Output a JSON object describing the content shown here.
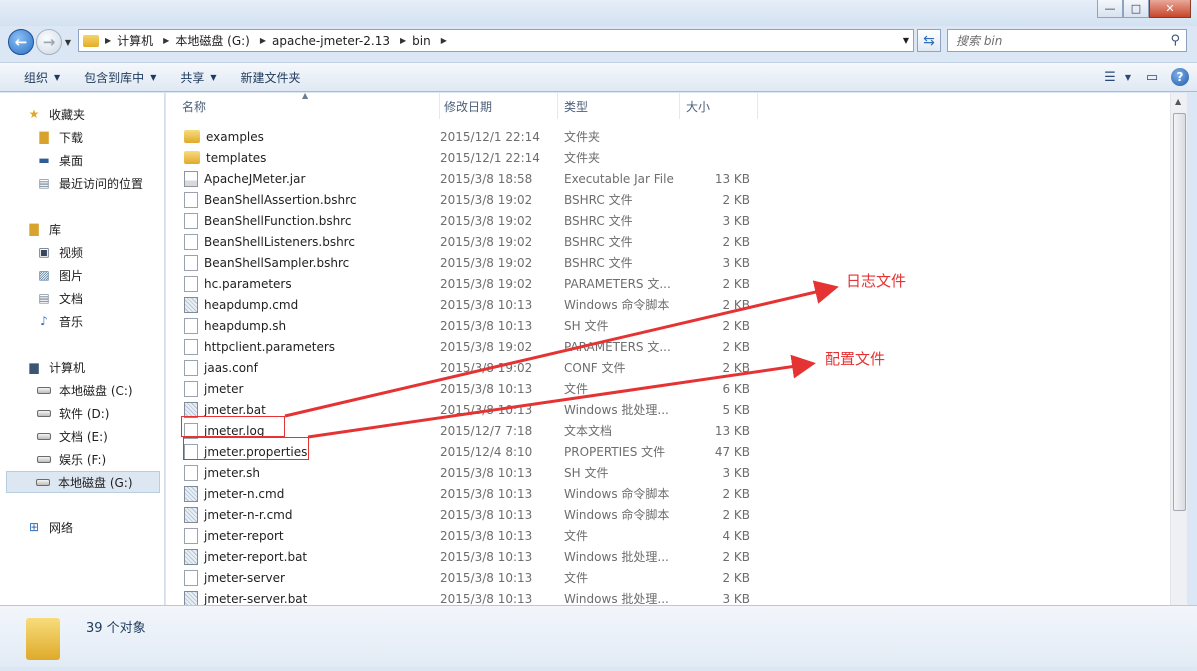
{
  "window": {
    "buttons": [
      "—",
      "□",
      "✕"
    ]
  },
  "address": {
    "crumbs": [
      "计算机",
      "本地磁盘 (G:)",
      "apache-jmeter-2.13",
      "bin"
    ],
    "search_placeholder": "搜索 bin"
  },
  "toolbar": {
    "organize": "组织",
    "include_library": "包含到库中",
    "share": "共享",
    "new_folder": "新建文件夹"
  },
  "nav": {
    "favorites": "收藏夹",
    "downloads": "下载",
    "desktop": "桌面",
    "recent": "最近访问的位置",
    "libraries": "库",
    "videos": "视频",
    "pictures": "图片",
    "documents": "文档",
    "music": "音乐",
    "computer": "计算机",
    "drive_c": "本地磁盘 (C:)",
    "drive_d": "软件 (D:)",
    "drive_e": "文档 (E:)",
    "drive_f": "娱乐 (F:)",
    "drive_g": "本地磁盘 (G:)",
    "network": "网络"
  },
  "columns": {
    "name": "名称",
    "date": "修改日期",
    "type": "类型",
    "size": "大小"
  },
  "files": [
    {
      "name": "examples",
      "date": "2015/12/1 22:14",
      "type": "文件夹",
      "size": "",
      "icon": "folder"
    },
    {
      "name": "templates",
      "date": "2015/12/1 22:14",
      "type": "文件夹",
      "size": "",
      "icon": "folder"
    },
    {
      "name": "ApacheJMeter.jar",
      "date": "2015/3/8 18:58",
      "type": "Executable Jar File",
      "size": "13 KB",
      "icon": "jar"
    },
    {
      "name": "BeanShellAssertion.bshrc",
      "date": "2015/3/8 19:02",
      "type": "BSHRC 文件",
      "size": "2 KB",
      "icon": "file"
    },
    {
      "name": "BeanShellFunction.bshrc",
      "date": "2015/3/8 19:02",
      "type": "BSHRC 文件",
      "size": "3 KB",
      "icon": "file"
    },
    {
      "name": "BeanShellListeners.bshrc",
      "date": "2015/3/8 19:02",
      "type": "BSHRC 文件",
      "size": "2 KB",
      "icon": "file"
    },
    {
      "name": "BeanShellSampler.bshrc",
      "date": "2015/3/8 19:02",
      "type": "BSHRC 文件",
      "size": "3 KB",
      "icon": "file"
    },
    {
      "name": "hc.parameters",
      "date": "2015/3/8 19:02",
      "type": "PARAMETERS 文...",
      "size": "2 KB",
      "icon": "file"
    },
    {
      "name": "heapdump.cmd",
      "date": "2015/3/8 10:13",
      "type": "Windows 命令脚本",
      "size": "2 KB",
      "icon": "app"
    },
    {
      "name": "heapdump.sh",
      "date": "2015/3/8 10:13",
      "type": "SH 文件",
      "size": "2 KB",
      "icon": "file"
    },
    {
      "name": "httpclient.parameters",
      "date": "2015/3/8 19:02",
      "type": "PARAMETERS 文...",
      "size": "2 KB",
      "icon": "file"
    },
    {
      "name": "jaas.conf",
      "date": "2015/3/8 19:02",
      "type": "CONF 文件",
      "size": "2 KB",
      "icon": "file"
    },
    {
      "name": "jmeter",
      "date": "2015/3/8 10:13",
      "type": "文件",
      "size": "6 KB",
      "icon": "file"
    },
    {
      "name": "jmeter.bat",
      "date": "2015/3/8 10:13",
      "type": "Windows 批处理...",
      "size": "5 KB",
      "icon": "app"
    },
    {
      "name": "jmeter.log",
      "date": "2015/12/7 7:18",
      "type": "文本文档",
      "size": "13 KB",
      "icon": "file"
    },
    {
      "name": "jmeter.properties",
      "date": "2015/12/4 8:10",
      "type": "PROPERTIES 文件",
      "size": "47 KB",
      "icon": "file"
    },
    {
      "name": "jmeter.sh",
      "date": "2015/3/8 10:13",
      "type": "SH 文件",
      "size": "3 KB",
      "icon": "file"
    },
    {
      "name": "jmeter-n.cmd",
      "date": "2015/3/8 10:13",
      "type": "Windows 命令脚本",
      "size": "2 KB",
      "icon": "app"
    },
    {
      "name": "jmeter-n-r.cmd",
      "date": "2015/3/8 10:13",
      "type": "Windows 命令脚本",
      "size": "2 KB",
      "icon": "app"
    },
    {
      "name": "jmeter-report",
      "date": "2015/3/8 10:13",
      "type": "文件",
      "size": "4 KB",
      "icon": "file"
    },
    {
      "name": "jmeter-report.bat",
      "date": "2015/3/8 10:13",
      "type": "Windows 批处理...",
      "size": "2 KB",
      "icon": "app"
    },
    {
      "name": "jmeter-server",
      "date": "2015/3/8 10:13",
      "type": "文件",
      "size": "2 KB",
      "icon": "file"
    },
    {
      "name": "jmeter-server.bat",
      "date": "2015/3/8 10:13",
      "type": "Windows 批处理...",
      "size": "3 KB",
      "icon": "app"
    }
  ],
  "status": {
    "count": "39 个对象"
  },
  "annotations": {
    "log_label": "日志文件",
    "config_label": "配置文件",
    "color": "#e53333"
  }
}
